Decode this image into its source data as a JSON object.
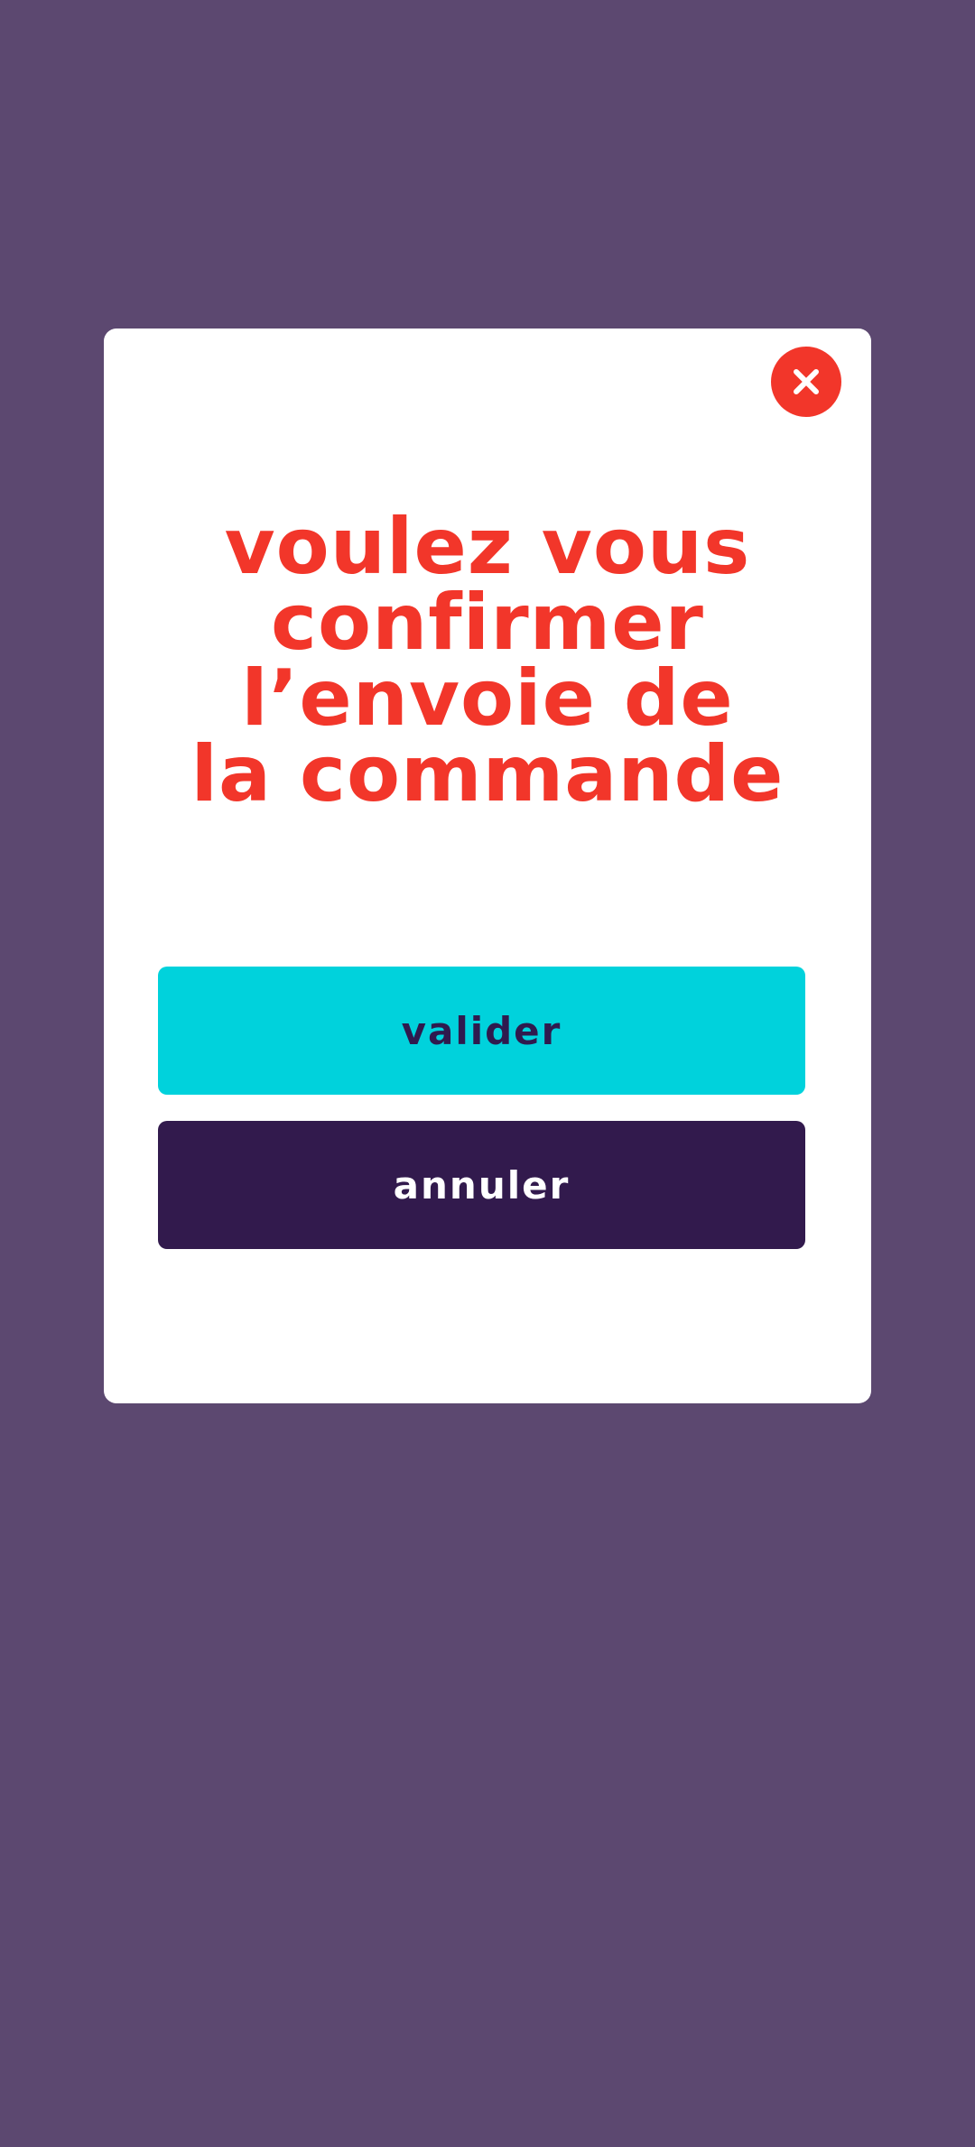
{
  "dialog": {
    "title": "voulez vous\nconfirmer\nl’envoie de\nla commande",
    "close_icon": "close-icon",
    "validate_label": "valider",
    "cancel_label": "annuler"
  },
  "colors": {
    "backdrop": "#5c4870",
    "dialog_background": "#ffffff",
    "accent_red": "#f2362a",
    "validate_button": "#00d2dc",
    "cancel_button": "#321a4d"
  }
}
